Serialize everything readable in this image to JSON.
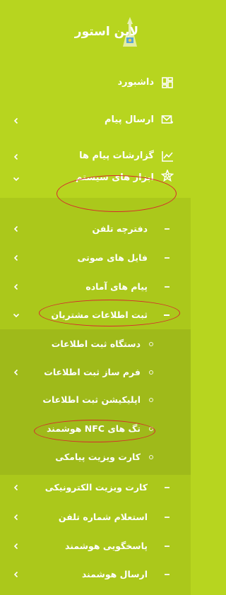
{
  "app": {
    "brand": "لاین استور"
  },
  "menu": {
    "dashboard": "داشبورد",
    "send_message": "ارسال پیام",
    "message_reports": "گزارشات پیام ها",
    "system_tools": "ابزار های سیستم"
  },
  "system_tools": {
    "phonebook": "دفترچه تلفن",
    "voice_files": "فایل های صوتی",
    "ready_messages": "پیام های آماده",
    "customer_registration": "ثبت اطلاعات مشتریان"
  },
  "customer_registration": {
    "device": "دستگاه ثبت اطلاعات",
    "form_builder": "فرم ساز ثبت اطلاعات",
    "app": "اپلیکیشن ثبت اطلاعات",
    "nfc_tags": "تگ های NFC هوشمند",
    "sms_card": "کارت ویزیت پیامکی"
  },
  "more_tools": {
    "e_business_card": "کارت ویزیت الکترونیکی",
    "phone_lookup": "استعلام شماره تلفن",
    "smart_responder": "پاسخگویی هوشمند",
    "smart_send": "ارسال هوشمند"
  },
  "colors": {
    "sidebar_bg": "#b7d51f",
    "submenu_bg": "#abc81b",
    "subsubmenu_bg": "#9fba1a",
    "annotation": "#d7282d"
  },
  "icons": [
    "logo-icon",
    "dashboard-icon",
    "send-message-icon",
    "chart-icon",
    "tools-icon",
    "chevron-left-icon",
    "chevron-down-icon"
  ]
}
